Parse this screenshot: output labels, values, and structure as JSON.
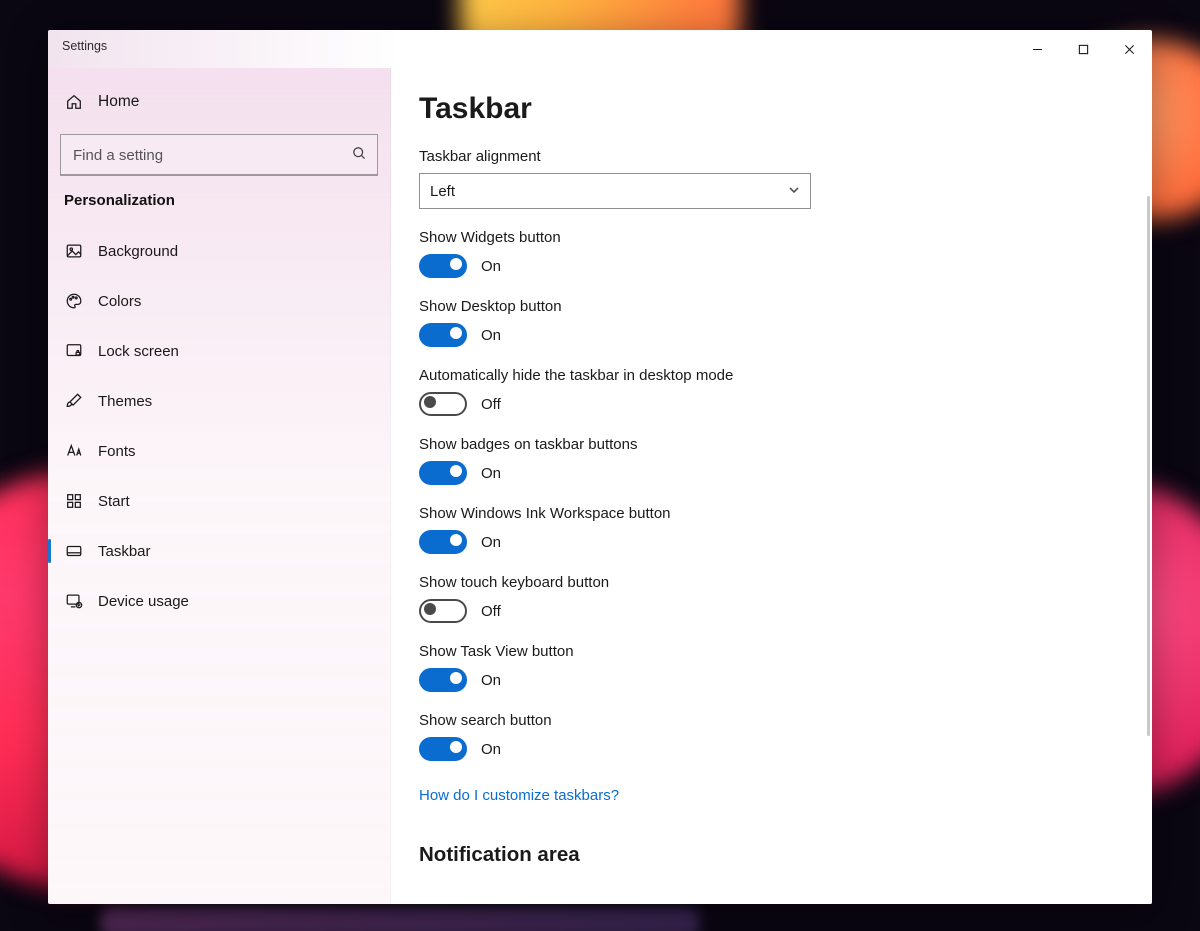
{
  "window": {
    "title": "Settings"
  },
  "sidebar": {
    "home": "Home",
    "search_placeholder": "Find a setting",
    "category": "Personalization",
    "items": [
      {
        "label": "Background"
      },
      {
        "label": "Colors"
      },
      {
        "label": "Lock screen"
      },
      {
        "label": "Themes"
      },
      {
        "label": "Fonts"
      },
      {
        "label": "Start"
      },
      {
        "label": "Taskbar"
      },
      {
        "label": "Device usage"
      }
    ]
  },
  "main": {
    "title": "Taskbar",
    "alignment_label": "Taskbar alignment",
    "alignment_value": "Left",
    "toggles": [
      {
        "label": "Show Widgets button",
        "on": true,
        "state": "On"
      },
      {
        "label": "Show Desktop button",
        "on": true,
        "state": "On"
      },
      {
        "label": "Automatically hide the taskbar in desktop mode",
        "on": false,
        "state": "Off"
      },
      {
        "label": "Show badges on taskbar buttons",
        "on": true,
        "state": "On"
      },
      {
        "label": "Show Windows Ink Workspace button",
        "on": true,
        "state": "On"
      },
      {
        "label": "Show touch keyboard button",
        "on": false,
        "state": "Off"
      },
      {
        "label": "Show Task View button",
        "on": true,
        "state": "On"
      },
      {
        "label": "Show search button",
        "on": true,
        "state": "On"
      }
    ],
    "help_link": "How do I customize taskbars?",
    "section2": "Notification area"
  }
}
